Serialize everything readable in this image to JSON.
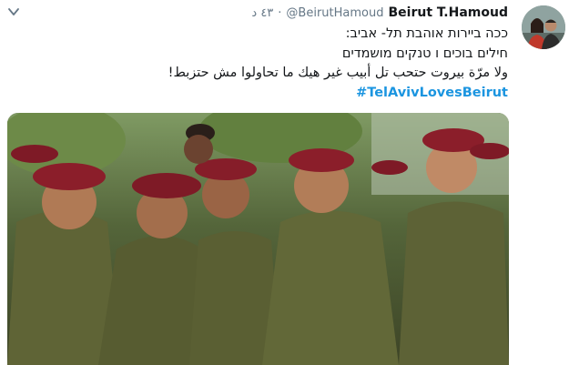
{
  "tweet": {
    "display_name": "Beirut T.Hamoud",
    "handle": "@BeirutHamoud",
    "separator": "·",
    "time": "٤٣ د",
    "lines": [
      "ככה ביירות אוהבת תל- אביב:",
      "חילים בוכים ו טנקים מושמדים",
      "ولا مرّة بيروت حتحب تل أبيب غير هيك ما تحاولوا مش حتزبط!"
    ],
    "hashtag": "#TelAvivLovesBeirut"
  },
  "colors": {
    "link": "#1b95e0",
    "text": "#14171a",
    "muted": "#657786",
    "beret": "#8b1e2a",
    "uniform": "#5d6236"
  },
  "icons": {
    "menu": "chevron-down-icon",
    "avatar": "user-avatar"
  }
}
